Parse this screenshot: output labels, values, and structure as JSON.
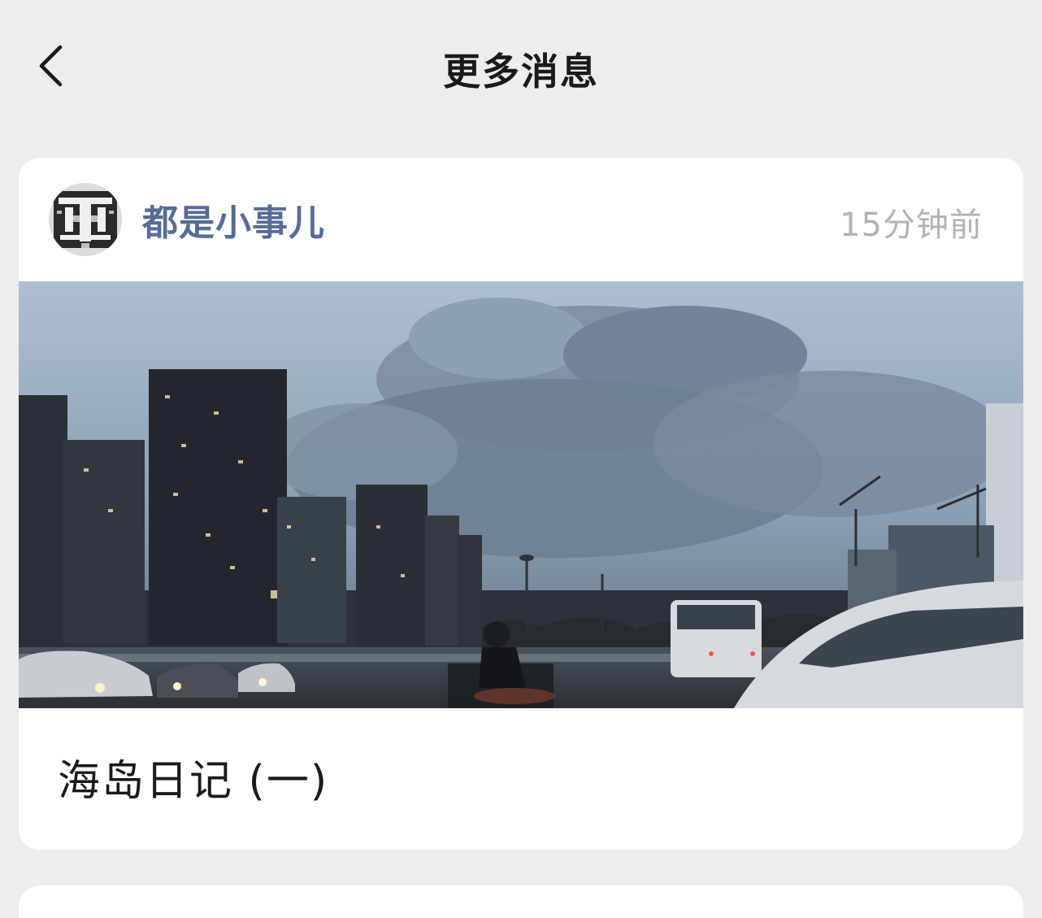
{
  "nav": {
    "back_icon": "chevron-left-icon",
    "title": "更多消息"
  },
  "message": {
    "author": "都是小事儿",
    "time": "15分钟前",
    "caption": "海岛日记 (一)"
  },
  "colors": {
    "background": "#ededed",
    "card": "#ffffff",
    "author_name": "#576b95",
    "timestamp": "#b2b2b2"
  }
}
